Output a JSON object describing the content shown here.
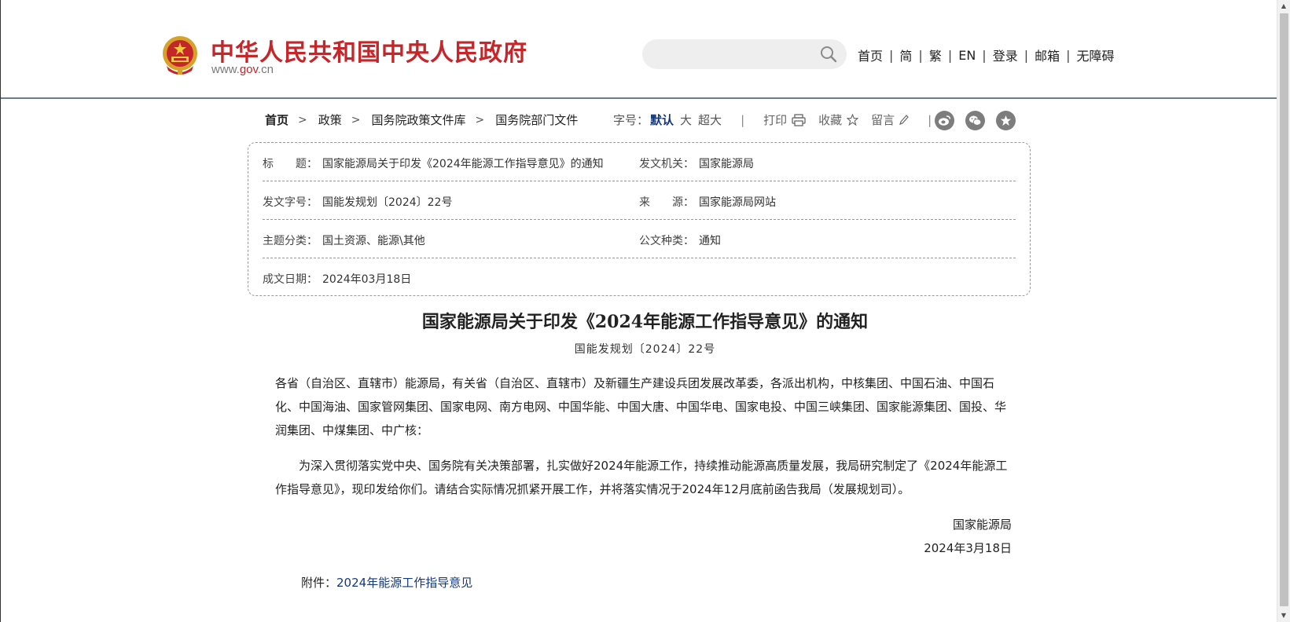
{
  "header": {
    "site_title": "中华人民共和国中央人民政府",
    "site_url_prefix": "www.",
    "site_url_gov": "gov",
    "site_url_suffix": ".cn",
    "search_placeholder": "",
    "nav": [
      {
        "label": "首页"
      },
      {
        "label": "简"
      },
      {
        "label": "繁"
      },
      {
        "label": "EN"
      },
      {
        "label": "登录"
      },
      {
        "label": "邮箱"
      },
      {
        "label": "无障碍"
      }
    ]
  },
  "breadcrumb": [
    {
      "label": "首页"
    },
    {
      "label": "政策"
    },
    {
      "label": "国务院政策文件库"
    },
    {
      "label": "国务院部门文件"
    }
  ],
  "tools": {
    "font_size_label": "字号：",
    "font_default": "默认",
    "font_large": "大",
    "font_xlarge": "超大",
    "print": "打印",
    "favorite": "收藏",
    "comment": "留言"
  },
  "share_icons": [
    "weibo-icon",
    "wechat-icon",
    "star-icon"
  ],
  "info": {
    "title_label": "标　　题：",
    "title_value": "国家能源局关于印发《2024年能源工作指导意见》的通知",
    "issuer_label": "发文机关：",
    "issuer_value": "国家能源局",
    "doc_no_label": "发文字号：",
    "doc_no_value": "国能发规划〔2024〕22号",
    "source_label": "来　　源：",
    "source_value": "国家能源局网站",
    "topic_label": "主题分类：",
    "topic_value": "国土资源、能源\\其他",
    "type_label": "公文种类：",
    "type_value": "通知",
    "date_label": "成文日期：",
    "date_value": "2024年03月18日"
  },
  "article": {
    "title": "国家能源局关于印发《2024年能源工作指导意见》的通知",
    "doc_no": "国能发规划〔2024〕22号",
    "para1": "各省（自治区、直辖市）能源局，有关省（自治区、直辖市）及新疆生产建设兵团发展改革委，各派出机构，中核集团、中国石油、中国石化、中国海油、国家管网集团、国家电网、南方电网、中国华能、中国大唐、中国华电、国家电投、中国三峡集团、国家能源集团、国投、华润集团、中煤集团、中广核：",
    "para2": "为深入贯彻落实党中央、国务院有关决策部署，扎实做好2024年能源工作，持续推动能源高质量发展，我局研究制定了《2024年能源工作指导意见》，现印发给你们。请结合实际情况抓紧开展工作，并将落实情况于2024年12月底前函告我局（发展规划司）。",
    "signer": "国家能源局",
    "sign_date": "2024年3月18日",
    "attach_label": "附件：",
    "attach_link": "2024年能源工作指导意见"
  },
  "colors": {
    "brand_red": "#c4262a",
    "link_blue": "#15387b"
  }
}
